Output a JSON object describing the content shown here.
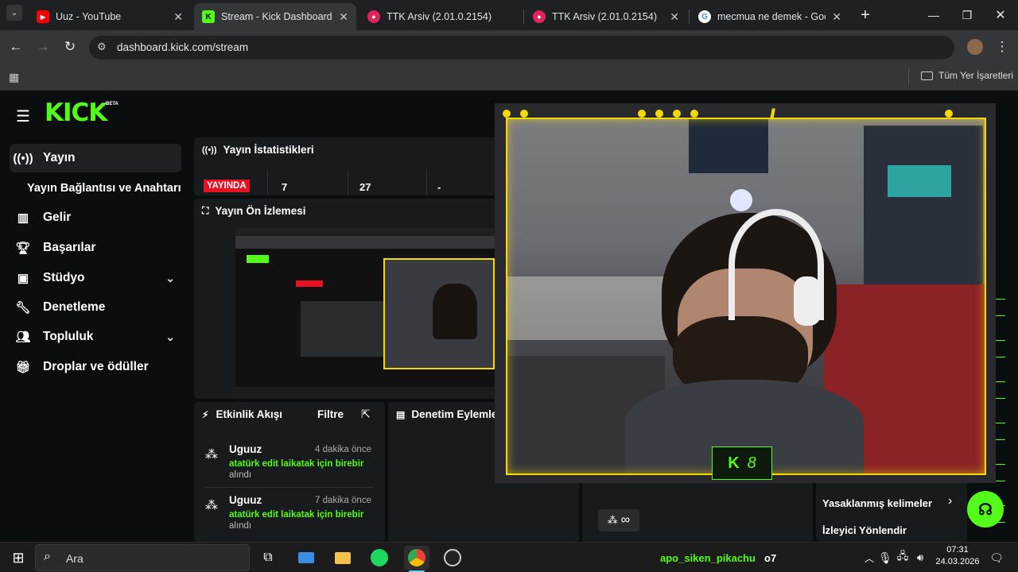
{
  "browser": {
    "tabs": [
      {
        "title": "Uuz - YouTube",
        "favicon": "youtube-icon",
        "color": "#ff0000"
      },
      {
        "title": "Stream - Kick Dashboard",
        "favicon": "kick-icon",
        "color": "#53fc18",
        "active": true
      },
      {
        "title": "TTK Arsiv (2.01.0.2154)",
        "favicon": "ttk-icon",
        "color": "#e0245e"
      },
      {
        "title": "TTK Arsiv (2.01.0.2154)",
        "favicon": "ttk-icon",
        "color": "#e0245e"
      },
      {
        "title": "mecmua ne demek - Google",
        "favicon": "google-icon",
        "color": "#4285f4"
      }
    ],
    "url": "dashboard.kick.com/stream",
    "bookmarks_label": "Tüm Yer İşaretleri"
  },
  "kick": {
    "logo": "KICK",
    "beta": "BETA",
    "sidebar": [
      {
        "label": "Yayın",
        "icon": "broadcast-icon",
        "active": true
      },
      {
        "label": "Yayın Bağlantısı ve Anahtarı",
        "sub": true
      },
      {
        "label": "Gelir",
        "icon": "chart-icon"
      },
      {
        "label": "Başarılar",
        "icon": "trophy-icon"
      },
      {
        "label": "Stüdyo",
        "icon": "studio-icon",
        "expand": true
      },
      {
        "label": "Denetleme",
        "icon": "wrench-icon"
      },
      {
        "label": "Topluluk",
        "icon": "users-icon",
        "expand": true
      },
      {
        "label": "Droplar ve ödüller",
        "icon": "gift-icon"
      }
    ],
    "stats": {
      "title": "Yayın İstatistikleri",
      "live_badge": "YAYINDA",
      "values": [
        "7",
        "27",
        "-"
      ]
    },
    "preview": {
      "title": "Yayın Ön İzlemesi"
    },
    "activity": {
      "title": "Etkinlik Akışı",
      "filter": "Filtre",
      "items": [
        {
          "user": "Uguuz",
          "time": "4 dakika önce",
          "message": "atatürk edit laikatak için birebir",
          "suffix": "alındı"
        },
        {
          "user": "Uguuz",
          "time": "7 dakika önce",
          "message": "atatürk edit laikatak için birebir",
          "suffix": "alındı"
        }
      ]
    },
    "moderation": {
      "title": "Denetim Eylemle"
    },
    "quick": {
      "infinity": "∞",
      "banned_words": "Yasaklanmış kelimeler",
      "raid": "İzleyici Yönlendir"
    },
    "chat_line": {
      "user": "apo_siken_pikachu",
      "text": "o7"
    },
    "overlay_badge": "8"
  },
  "taskbar": {
    "search": "Ara",
    "time": "07:31",
    "date": "24.03.2026"
  },
  "colors": {
    "kick_green": "#53fc18",
    "live_red": "#e81123",
    "overlay_yellow": "#f5d90a"
  }
}
